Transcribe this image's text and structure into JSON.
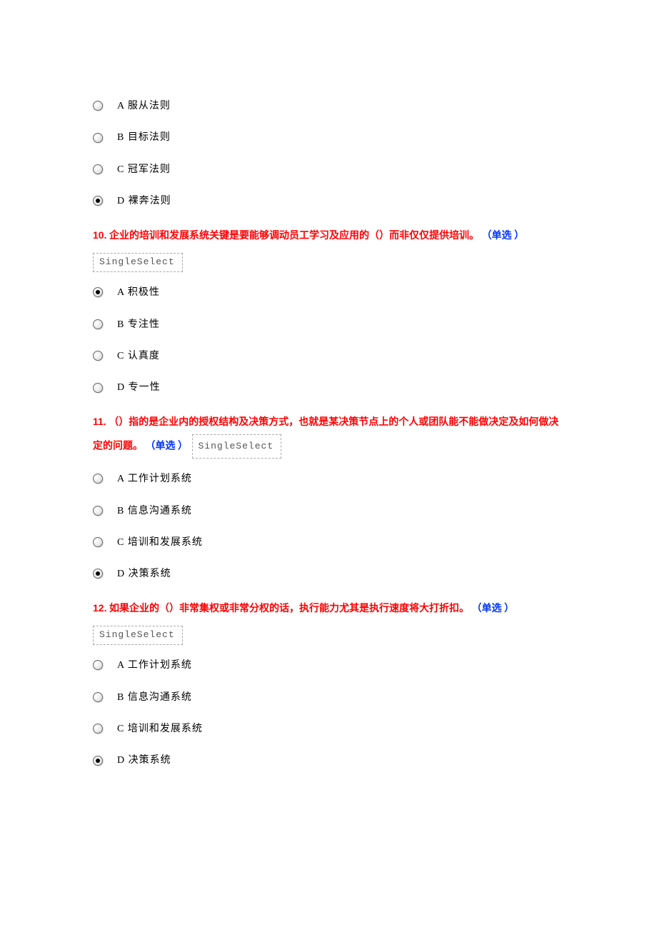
{
  "q9": {
    "options": {
      "a": "A 服从法则",
      "b": "B 目标法则",
      "c": "C 冠军法则",
      "d": "D 裸奔法则"
    }
  },
  "q10": {
    "number": "10.",
    "text": "企业的培训和发展系统关键是要能够调动员工学习及应用的（）而非仅仅提供培训。",
    "flag": "（单选 ）",
    "selectLabel": "SingleSelect",
    "options": {
      "a": "A 积极性",
      "b": "B 专注性",
      "c": "C 认真度",
      "d": "D 专一性"
    }
  },
  "q11": {
    "number": "11.",
    "text": "（）指的是企业内的授权结构及决策方式，也就是某决策节点上的个人或团队能不能做决定及如何做决定的问题。",
    "flag": "（单选 ）",
    "selectLabel": "SingleSelect",
    "options": {
      "a": "A 工作计划系统",
      "b": "B 信息沟通系统",
      "c": "C 培训和发展系统",
      "d": "D 决策系统"
    }
  },
  "q12": {
    "number": "12.",
    "text": "如果企业的（）非常集权或非常分权的话，执行能力尤其是执行速度将大打折扣。",
    "flag": "（单选 ）",
    "selectLabel": "SingleSelect",
    "options": {
      "a": "A 工作计划系统",
      "b": "B 信息沟通系统",
      "c": "C 培训和发展系统",
      "d": "D 决策系统"
    }
  }
}
